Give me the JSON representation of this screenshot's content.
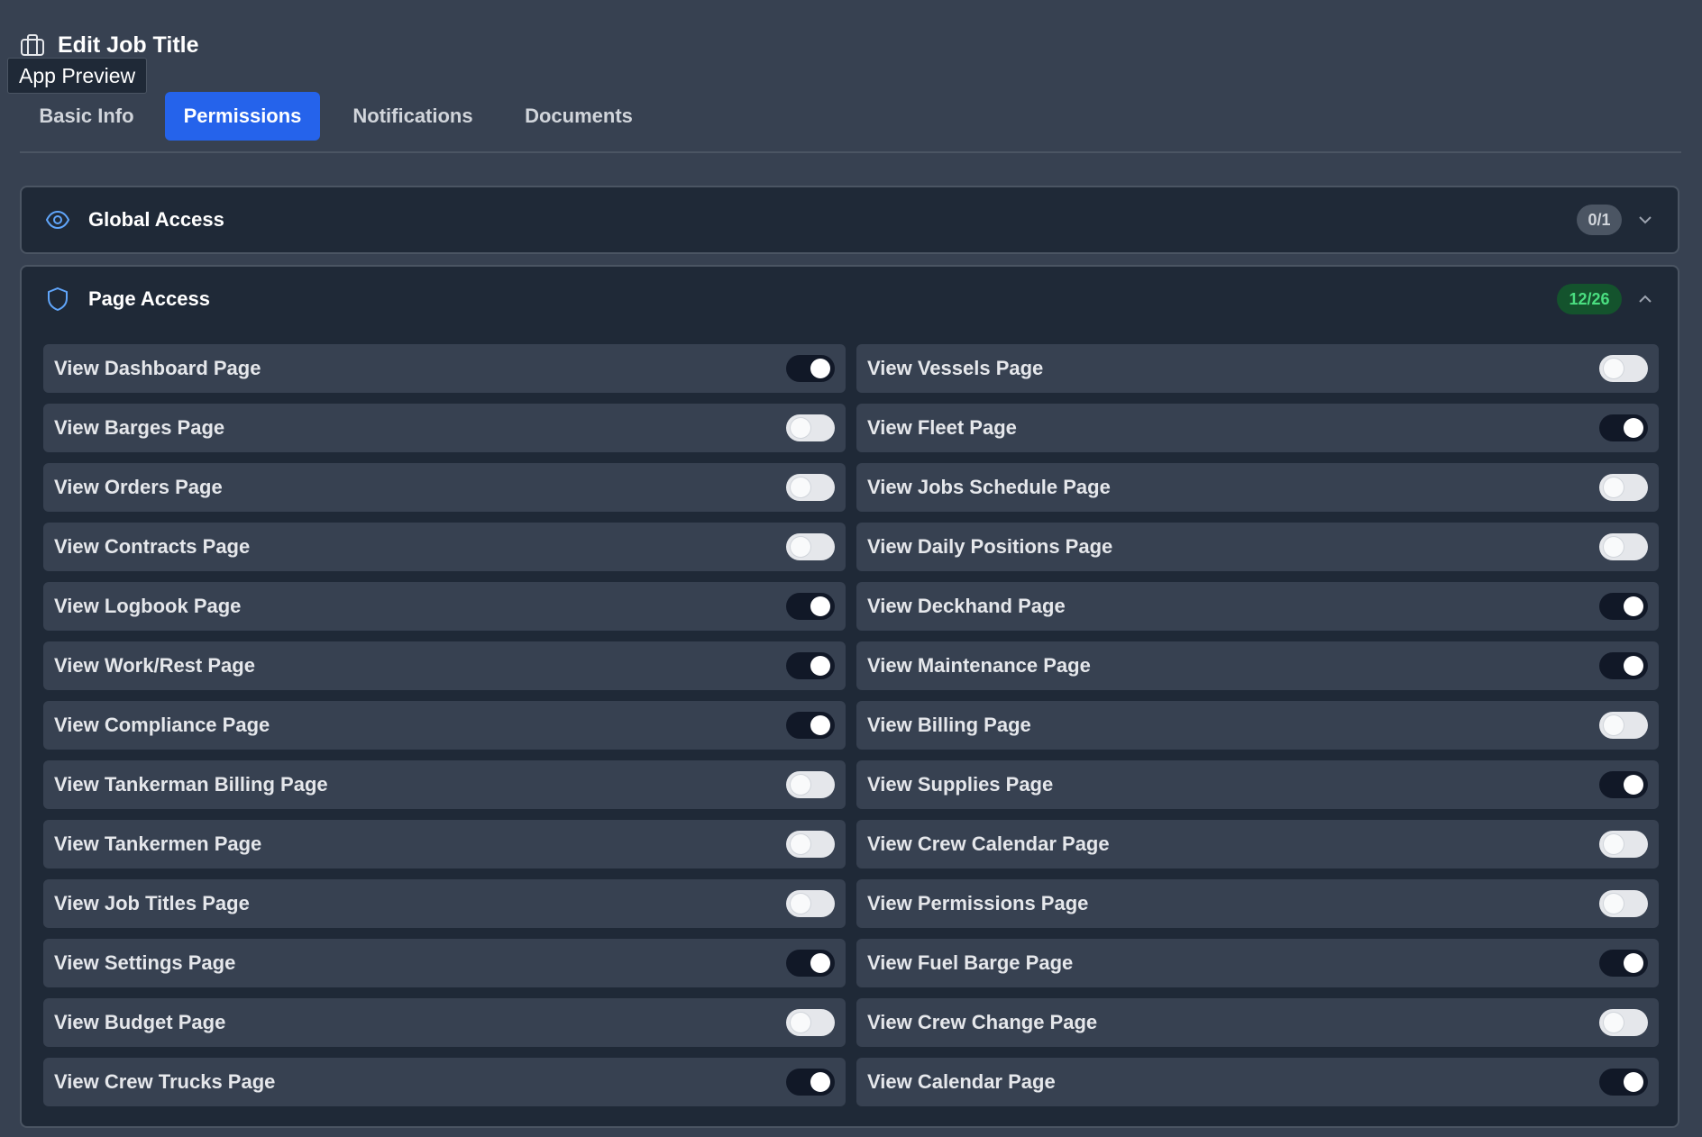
{
  "header": {
    "title": "Edit Job Title",
    "icon": "briefcase-icon"
  },
  "tooltip": {
    "text": "App Preview"
  },
  "tabs": [
    {
      "label": "Basic Info",
      "active": false
    },
    {
      "label": "Permissions",
      "active": true
    },
    {
      "label": "Notifications",
      "active": false
    },
    {
      "label": "Documents",
      "active": false
    }
  ],
  "sections": {
    "global": {
      "title": "Global Access",
      "count": "0/1",
      "icon": "eye-icon",
      "expanded": false
    },
    "page": {
      "title": "Page Access",
      "count": "12/26",
      "icon": "shield-icon",
      "expanded": true
    }
  },
  "colors": {
    "accent": "#2563eb",
    "badge_green_text": "#4ade80",
    "badge_green_bg": "#14532d"
  },
  "permissions": [
    {
      "label": "View Dashboard Page",
      "on": true
    },
    {
      "label": "View Vessels Page",
      "on": false
    },
    {
      "label": "View Barges Page",
      "on": false
    },
    {
      "label": "View Fleet Page",
      "on": true
    },
    {
      "label": "View Orders Page",
      "on": false
    },
    {
      "label": "View Jobs Schedule Page",
      "on": false
    },
    {
      "label": "View Contracts Page",
      "on": false
    },
    {
      "label": "View Daily Positions Page",
      "on": false
    },
    {
      "label": "View Logbook Page",
      "on": true
    },
    {
      "label": "View Deckhand Page",
      "on": true
    },
    {
      "label": "View Work/Rest Page",
      "on": true
    },
    {
      "label": "View Maintenance Page",
      "on": true
    },
    {
      "label": "View Compliance Page",
      "on": true
    },
    {
      "label": "View Billing Page",
      "on": false
    },
    {
      "label": "View Tankerman Billing Page",
      "on": false
    },
    {
      "label": "View Supplies Page",
      "on": true
    },
    {
      "label": "View Tankermen Page",
      "on": false
    },
    {
      "label": "View Crew Calendar Page",
      "on": false
    },
    {
      "label": "View Job Titles Page",
      "on": false
    },
    {
      "label": "View Permissions Page",
      "on": false
    },
    {
      "label": "View Settings Page",
      "on": true
    },
    {
      "label": "View Fuel Barge Page",
      "on": true
    },
    {
      "label": "View Budget Page",
      "on": false
    },
    {
      "label": "View Crew Change Page",
      "on": false
    },
    {
      "label": "View Crew Trucks Page",
      "on": true
    },
    {
      "label": "View Calendar Page",
      "on": true
    }
  ]
}
